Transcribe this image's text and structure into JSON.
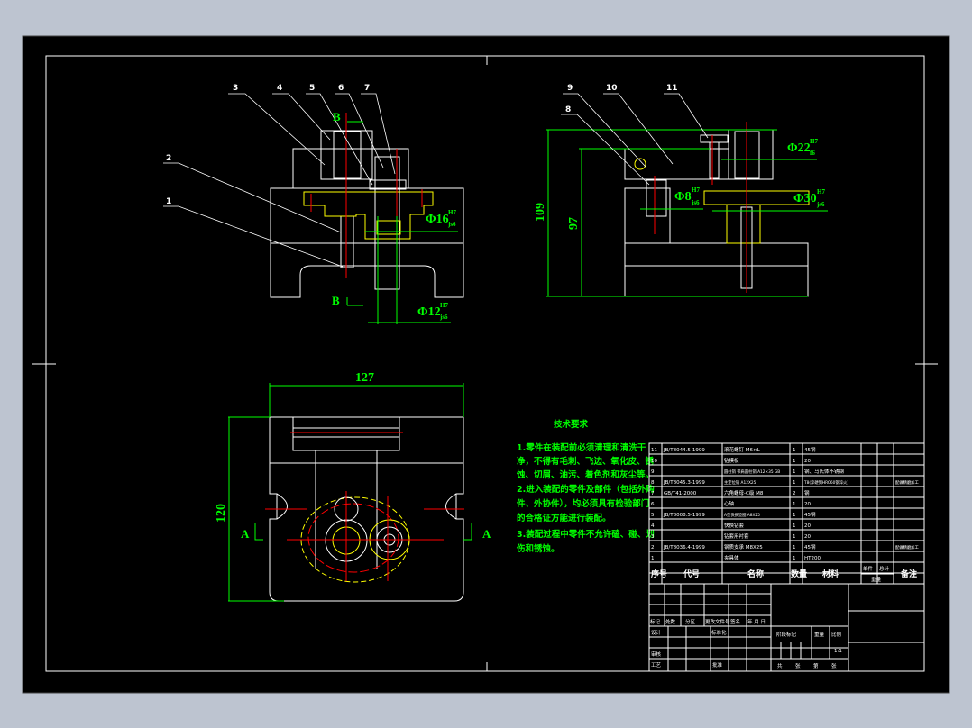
{
  "colors": {
    "background": "#bdc4d0",
    "canvas": "#000000",
    "outline": "#ffffff",
    "dimension": "#00ff00",
    "centerline": "#ff0000",
    "hidden": "#ffff00",
    "hatch": "#00ffff"
  },
  "front_view": {
    "part_labels": [
      "1",
      "2",
      "3",
      "4",
      "5",
      "6",
      "7"
    ],
    "section_label_top": "B",
    "section_label_bottom": "B",
    "dim_fit_1": {
      "size": "Φ16",
      "upper": "H7",
      "lower": "js6"
    },
    "dim_fit_2": {
      "size": "Φ12",
      "upper": "H7",
      "lower": "js6"
    }
  },
  "side_view": {
    "part_labels": [
      "8",
      "9",
      "10",
      "11"
    ],
    "dim_height_total": "109",
    "dim_height_inner": "97",
    "dim_fit_1": {
      "size": "Φ22",
      "upper": "H7",
      "lower": "f6"
    },
    "dim_fit_2": {
      "size": "Φ8",
      "upper": "H7",
      "lower": "js6"
    },
    "dim_fit_3": {
      "size": "Φ30",
      "upper": "H7",
      "lower": "js6"
    }
  },
  "top_view": {
    "dim_width": "127",
    "dim_height": "120",
    "section_left": "A",
    "section_right": "A"
  },
  "tech_requirements": {
    "title": "技术要求",
    "lines": [
      "1.零件在装配前必须清理和清洗干",
      "净，不得有毛刺、飞边、氧化皮、锈",
      "蚀、切屑、油污、着色剂和灰尘等。",
      "2.进入装配的零件及部件（包括外购",
      "件、外协件），均必须具有检验部门",
      "的合格证方能进行装配。",
      "3.装配过程中零件不允许磕、碰、划",
      "伤和锈蚀。"
    ]
  },
  "bom": {
    "rows": [
      {
        "no": "11",
        "code": "JB/T8044.5-1999",
        "name": "滚花螺钉 M6×L",
        "qty": "1",
        "material": "45钢",
        "remark": ""
      },
      {
        "no": "10",
        "code": "",
        "name": "钻模板",
        "qty": "1",
        "material": "20",
        "remark": ""
      },
      {
        "no": "9",
        "code": "",
        "name": "圆柱销 带肩圆柱销 A12×35 GB",
        "qty": "1",
        "material": "钢、马氏体不锈钢",
        "remark": ""
      },
      {
        "no": "8",
        "code": "JB/T8045.3-1999",
        "name": "主定位销 A12X25",
        "qty": "1",
        "material": "T8(淬硬到HRC60钢淬火)",
        "remark": "配做精磨加工"
      },
      {
        "no": "7",
        "code": "GB/T41-2000",
        "name": "六角螺母-C级 M8",
        "qty": "2",
        "material": "钢",
        "remark": ""
      },
      {
        "no": "6",
        "code": "",
        "name": "心轴",
        "qty": "1",
        "material": "20",
        "remark": ""
      },
      {
        "no": "5",
        "code": "JB/T8008.5-1999",
        "name": "A型快换垫圈 A8X25",
        "qty": "1",
        "material": "45钢",
        "remark": ""
      },
      {
        "no": "4",
        "code": "",
        "name": "快换钻套",
        "qty": "1",
        "material": "20",
        "remark": ""
      },
      {
        "no": "3",
        "code": "",
        "name": "钻套用衬套",
        "qty": "1",
        "material": "20",
        "remark": ""
      },
      {
        "no": "2",
        "code": "JB/T8036.4-1999",
        "name": "钢质支承 M8X25",
        "qty": "1",
        "material": "45钢",
        "remark": "配做精磨加工"
      },
      {
        "no": "1",
        "code": "",
        "name": "夹具体",
        "qty": "1",
        "material": "HT200",
        "remark": ""
      }
    ],
    "header": {
      "no": "序号",
      "code": "代号",
      "name": "名称",
      "qty": "数量",
      "material": "材料",
      "unit": "单件",
      "total": "总计",
      "weight": "重量",
      "remark": "备注"
    }
  },
  "title_block": {
    "rev_labels": [
      "标记",
      "处数",
      "分区",
      "更改文件号",
      "签名",
      "年.月.日"
    ],
    "design": "设计",
    "standard": "标准化",
    "review": "审核",
    "process": "工艺",
    "approve": "批准",
    "stage": "阶段标记",
    "weight": "重量",
    "scale": "比例",
    "scale_value": "1:1",
    "sheets": [
      "共",
      "张",
      "第",
      "张"
    ]
  }
}
